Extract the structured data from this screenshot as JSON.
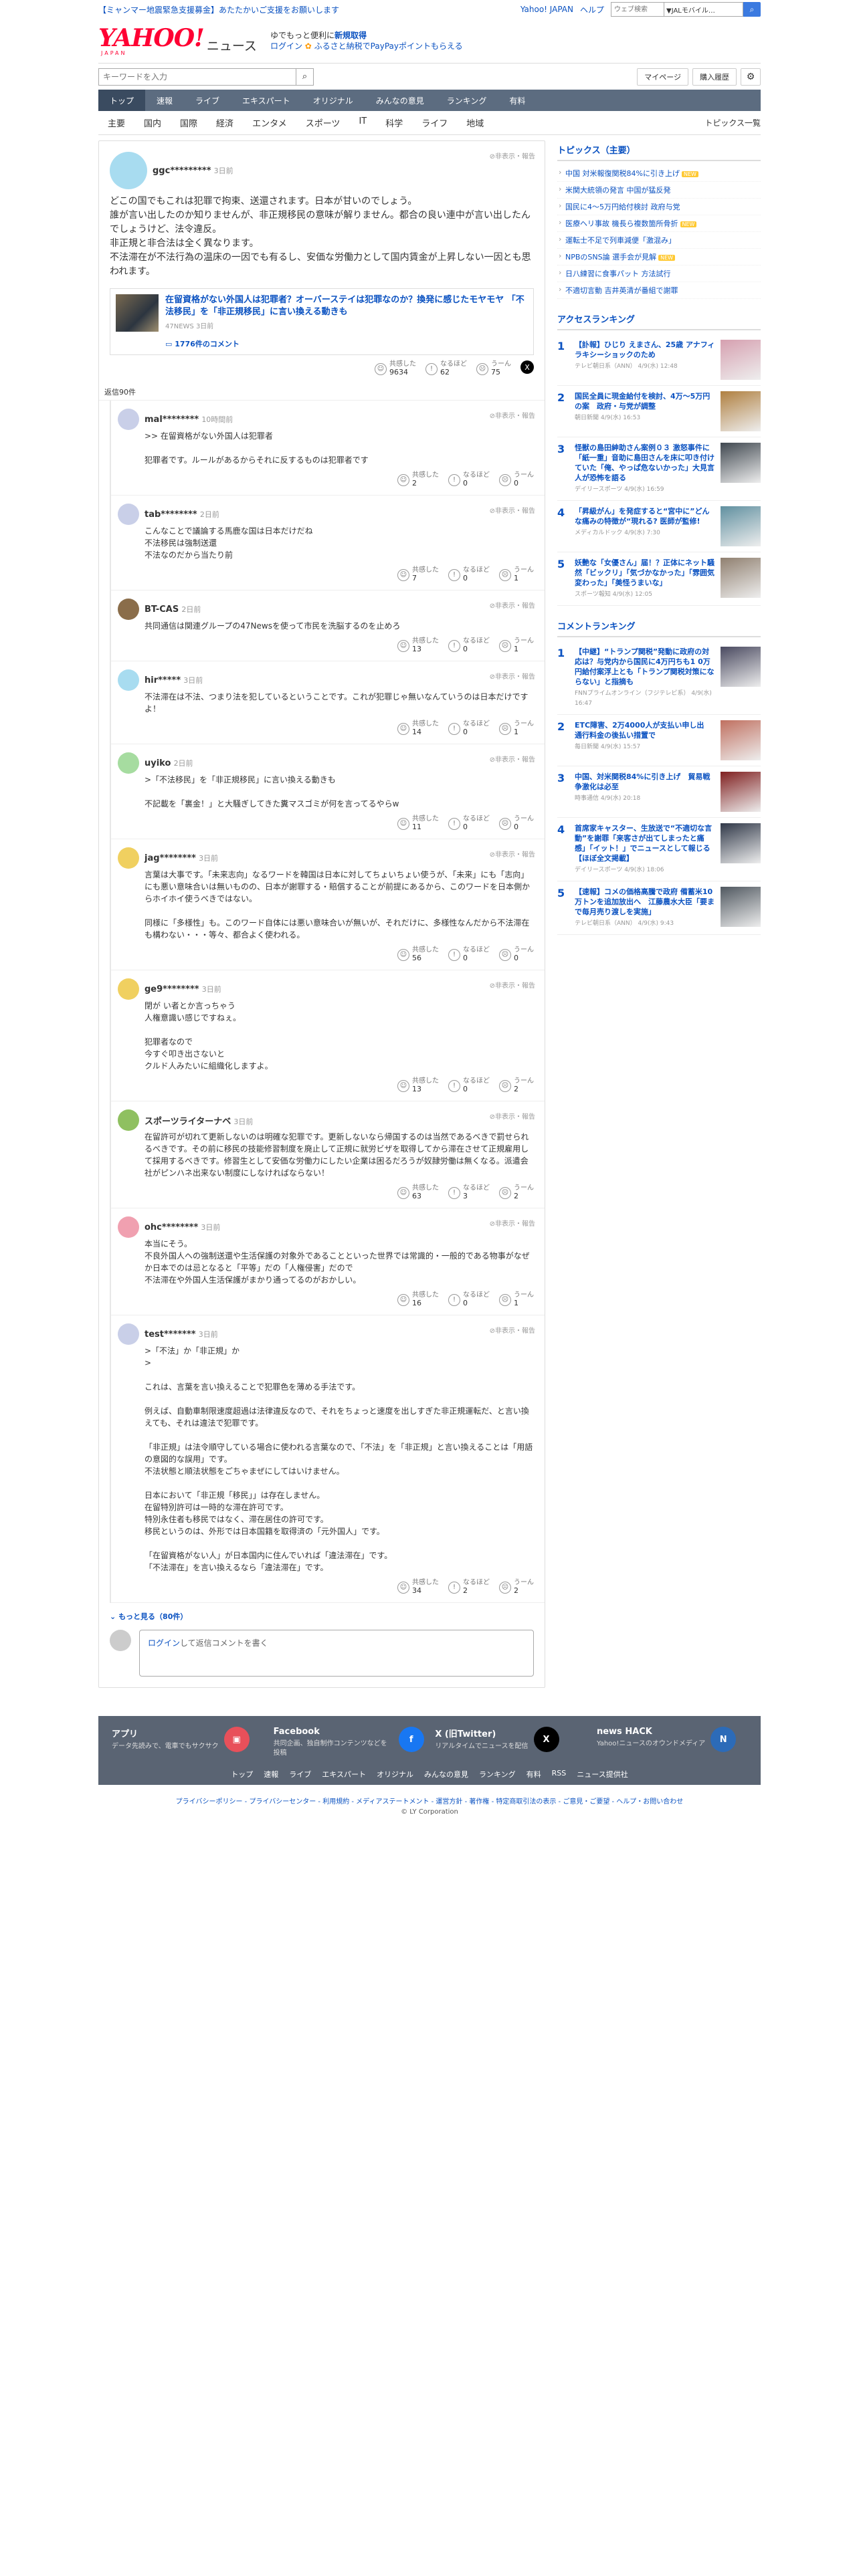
{
  "notice": {
    "left": "【ミャンマー地震緊急支援募金】あたたかいご支援をお願いします",
    "links": [
      "Yahoo! JAPAN",
      "ヘルプ"
    ],
    "search_placeholder": "ウェブ検索",
    "search_select": "▼JALモバイル…"
  },
  "brand": {
    "logo": "YAHOO!",
    "logo_sub": "JAPAN",
    "service": "ニュース",
    "promo1": "ゆでもっと便利に",
    "promo1b": "新規取得",
    "promo2a": "ログイン",
    "promo2b": "ふるさと納税でPayPayポイントもらえる"
  },
  "toolbar": {
    "search_placeholder": "キーワードを入力",
    "mypage": "マイページ",
    "history": "購入履歴"
  },
  "nav": [
    "トップ",
    "速報",
    "ライブ",
    "エキスパート",
    "オリジナル",
    "みんなの意見",
    "ランキング",
    "有料"
  ],
  "subnav": [
    "主要",
    "国内",
    "国際",
    "経済",
    "エンタメ",
    "スポーツ",
    "IT",
    "科学",
    "ライフ",
    "地域"
  ],
  "subnav_all": "トピックス一覧",
  "top": {
    "user": "ggc*********",
    "time": "3日前",
    "hide": "非表示・報告",
    "body": "どこの国でもこれは犯罪で拘束、送還されます。日本が甘いのでしょう。\n誰が言い出したのか知りませんが、非正規移民の意味が解りません。都合の良い連中が言い出したんでしょうけど、法令違反。\n非正規と非合法は全く異なります。\n不法滞在が不法行為の温床の一因でも有るし、安価な労働力として国内賃金が上昇しない一因とも思われます。",
    "article_title": "在留資格がない外国人は犯罪者？オーバーステイは犯罪なのか？換発に感じたモヤモヤ 「不法移民」を「非正規移民」に言い換える動きも",
    "article_src": "47NEWS 3日前",
    "article_count": "1776件のコメント",
    "a1": "共感した",
    "a1n": "9634",
    "a2": "なるほど",
    "a2n": "62",
    "a3": "うーん",
    "a3n": "75"
  },
  "reply_count": "返信90件",
  "replies": [
    {
      "user": "mal********",
      "time": "10時間前",
      "body": ">> 在留資格がない外国人は犯罪者\n\n犯罪者です。ルールがあるからそれに反するものは犯罪者です",
      "n1": "2",
      "n2": "0",
      "n3": "0",
      "color": "#c9cfe8"
    },
    {
      "user": "tab********",
      "time": "2日前",
      "body": "こんなことで議論する馬鹿な国は日本だけだね\n不法移民は強制送還\n不法なのだから当たり前",
      "n1": "7",
      "n2": "0",
      "n3": "1",
      "color": "#c9cfe8"
    },
    {
      "user": "BT-CAS",
      "time": "2日前",
      "body": "共同通信は関連グループの47Newsを使って市民を洗脳するのを止めろ",
      "n1": "13",
      "n2": "0",
      "n3": "1",
      "color": "#8a6d4a"
    },
    {
      "user": "hir*****",
      "time": "3日前",
      "body": "不法滞在は不法、つまり法を犯しているということです。これが犯罪じゃ無いなんていうのは日本だけですよ！",
      "n1": "14",
      "n2": "0",
      "n3": "1",
      "color": "#a8dcf0"
    },
    {
      "user": "uyiko",
      "time": "2日前",
      "body": ">「不法移民」を「非正規移民」に言い換える動きも\n\n不記載を「裏金！」と大騒ぎしてきた糞マスゴミが何を言ってるやらw",
      "n1": "11",
      "n2": "0",
      "n3": "0",
      "color": "#a6dca0"
    },
    {
      "user": "jag********",
      "time": "3日前",
      "body": "言葉は大事です。「未来志向」なるワードを韓国は日本に対してちょいちょい使うが、「未来」にも「志向」にも悪い意味合いは無いものの、日本が謝罪する・賠償することが前提にあるから、このワードを日本側からホイホイ使うべきではない。\n\n同様に「多様性」も。このワード自体には悪い意味合いが無いが、それだけに、多様性なんだから不法滞在も構わない・・・等々、都合よく使われる。",
      "n1": "56",
      "n2": "0",
      "n3": "0",
      "color": "#f0d060"
    },
    {
      "user": "ge9********",
      "time": "3日前",
      "body": "閉が い者とか言っちゃう\n人権意識い感じですねぇ。\n\n犯罪者なので\n今すぐ叩き出さないと\nクルド人みたいに組織化しますよ。",
      "n1": "13",
      "n2": "0",
      "n3": "2",
      "color": "#f0d060"
    },
    {
      "user": "スポーツライターナベ",
      "time": "3日前",
      "body": "在留許可が切れて更新しないのは明確な犯罪です。更新しないなら帰国するのは当然であるべきで罰せられるべきです。その前に移民の技能修習制度を廃止して正規に就労ビザを取得してから滞在させて正規雇用して採用するべきです。修習生として安価な労働力にしたい企業は困るだろうが奴隷労働は無くなる。派遣会社がピンハネ出来ない制度にしなければならない！",
      "n1": "63",
      "n2": "3",
      "n3": "2",
      "color": "#8fc060"
    },
    {
      "user": "ohc********",
      "time": "3日前",
      "body": "本当にそう。\n不良外国人への強制送還や生活保護の対象外であることといった世界では常識的・一般的である物事がなぜか日本でのは忌となると「平等」だの「人権侵害」だので\n不法滞在や外国人生活保護がまかり通ってるのがおかしい。",
      "n1": "16",
      "n2": "0",
      "n3": "1",
      "color": "#f0a0b0"
    },
    {
      "user": "test*******",
      "time": "3日前",
      "body": ">「不法」か「非正規」か\n>\n\nこれは、言葉を言い換えることで犯罪色を薄める手法です。\n\n例えば、自動車制限速度超過は法律違反なので、それをちょっと速度を出しすぎた非正規運転だ、と言い換えても、それは違法で犯罪です。\n\n「非正規」は法令順守している場合に使われる言葉なので、「不法」を「非正規」と言い換えることは「用語の意図的な誤用」です。\n不法状態と順法状態をごちゃまぜにしてはいけません。\n\n日本において「非正規「移民」」は存在しません。\n在留特別許可は一時的な滞在許可です。\n特別永住者も移民ではなく、滞在居住の許可です。\n移民というのは、外形では日本国籍を取得済の「元外国人」です。\n\n「在留資格がない人」が日本国内に住んでいれば「違法滞在」です。\n「不法滞在」を言い換えるなら「違法滞在」です。",
      "n1": "34",
      "n2": "2",
      "n3": "2",
      "color": "#c9cfe8"
    }
  ],
  "labels": {
    "a1": "共感した",
    "a2": "なるほど",
    "a3": "うーん",
    "hide": "非表示・報告"
  },
  "more": "もっと見る（80件）",
  "post": {
    "login": "ログイン",
    "rest": "して返信コメントを書く"
  },
  "side": {
    "topics_h": "トピックス（主要）",
    "topics": [
      {
        "t": "中国 対米報復関税84%に引き上げ",
        "new": true
      },
      {
        "t": "米関大統領の発言 中国が猛反発",
        "new": false
      },
      {
        "t": "国民に4～5万円給付検討 政府与党",
        "new": false
      },
      {
        "t": "医療ヘリ事故 機長ら複数箇所骨折",
        "new": true
      },
      {
        "t": "運転士不足で列車減便「激混み」",
        "new": false
      },
      {
        "t": "NPBのSNS論 選手会が見解",
        "new": true
      },
      {
        "t": "日八練習に食事パット 方法試行",
        "new": false
      },
      {
        "t": "不適切言動 吉井英清が番組で謝罪",
        "new": false
      }
    ],
    "access_h": "アクセスランキング",
    "access": [
      {
        "no": "1",
        "t": "【訃報】ひじり えまさん、25歳 アナフィラキシーショックのため",
        "s": "テレビ朝日系（ANN） 4/9(水) 12:48",
        "c": "#d6a0b0"
      },
      {
        "no": "2",
        "t": "国民全員に現金給付を検討、4万～5万円の案　政府・与党が調整",
        "s": "朝日新聞 4/9(水) 16:53",
        "c": "#b08040"
      },
      {
        "no": "3",
        "t": "怪獣の島田紳助さん案例０３ 激怒事件に「紙一重」音助に島田さんを床に叩き付けていた「俺、やっぱ危ないかった」大見言人が恐怖を語る",
        "s": "デイリースポーツ 4/9(水) 16:59",
        "c": "#404850"
      },
      {
        "no": "4",
        "t": "「昇級がん」を発症すると“宮中に”どんな痛みの特徴が“現れる? 医師が監修!",
        "s": "メディカルドック 4/9(水) 7:30",
        "c": "#6090a0"
      },
      {
        "no": "5",
        "t": "妖艶な「女優さん」届！？正体にネット騒然「ビックリ」「気づかなかった」「雰囲気変わった」「美怪うまいな」",
        "s": "スポーツ報知 4/9(水) 12:05",
        "c": "#908070"
      }
    ],
    "comment_h": "コメントランキング",
    "comments": [
      {
        "no": "1",
        "t": "【中継】“トランプ関税”発動に政府の対応は？与党内から国民に4万円ちも1 0万円給付案浮上とも「トランプ関税対策にならない」と指摘も",
        "s": "FNNプライムオンライン（フジテレビ系） 4/9(水) 16:47",
        "c": "#4a4a60"
      },
      {
        "no": "2",
        "t": "ETC障害、2万4000人が支払い申し出　通行料金の後払い措置で",
        "s": "毎日新聞 4/9(水) 15:57",
        "c": "#c07060"
      },
      {
        "no": "3",
        "t": "中国、対米関税84%に引き上げ　貿易戦争激化は必至",
        "s": "時事通信 4/9(水) 20:18",
        "c": "#802020"
      },
      {
        "no": "4",
        "t": "首席家キャスター、生放送で“不適切な言動”を謝罪「来客さが出てしまったと痛感」「イット！」でニュースとして報じる【ほぼ全文掲載】",
        "s": "デイリースポーツ 4/9(水) 18:06",
        "c": "#303848"
      },
      {
        "no": "5",
        "t": "【速報】コメの価格高騰で政府 備蓄米10万トンを追加放出へ　江藤農水大臣「要まで毎月売り渡しを実施」",
        "s": "テレビ朝日系（ANN） 4/9(水) 9:43",
        "c": "#505860"
      }
    ]
  },
  "footer": {
    "items": [
      {
        "t": "アプリ",
        "d": "データ先読みで、電車でもサクサク",
        "c": "#e8505a"
      },
      {
        "t": "Facebook",
        "d": "共同企画、独自制作コンテンツなどを投稿",
        "c": "#1877f2"
      },
      {
        "t": "X (旧Twitter)",
        "d": "リアルタイムでニュースを配信",
        "c": "#000000"
      },
      {
        "t": "news HACK",
        "d": "Yahoo!ニュースのオウンドメディア",
        "c": "#2c6bb8"
      }
    ],
    "links": [
      "トップ",
      "速報",
      "ライブ",
      "エキスパート",
      "オリジナル",
      "みんなの意見",
      "ランキング",
      "有料",
      "RSS",
      "ニュース提供社"
    ],
    "legal": "プライバシーポリシー - プライバシーセンター - 利用規約 - メディアステートメント - 運営方針 - 著作権 - 特定商取引法の表示 - ご意見・ご要望 - ヘルプ・お問い合わせ",
    "copy": "© LY Corporation"
  }
}
